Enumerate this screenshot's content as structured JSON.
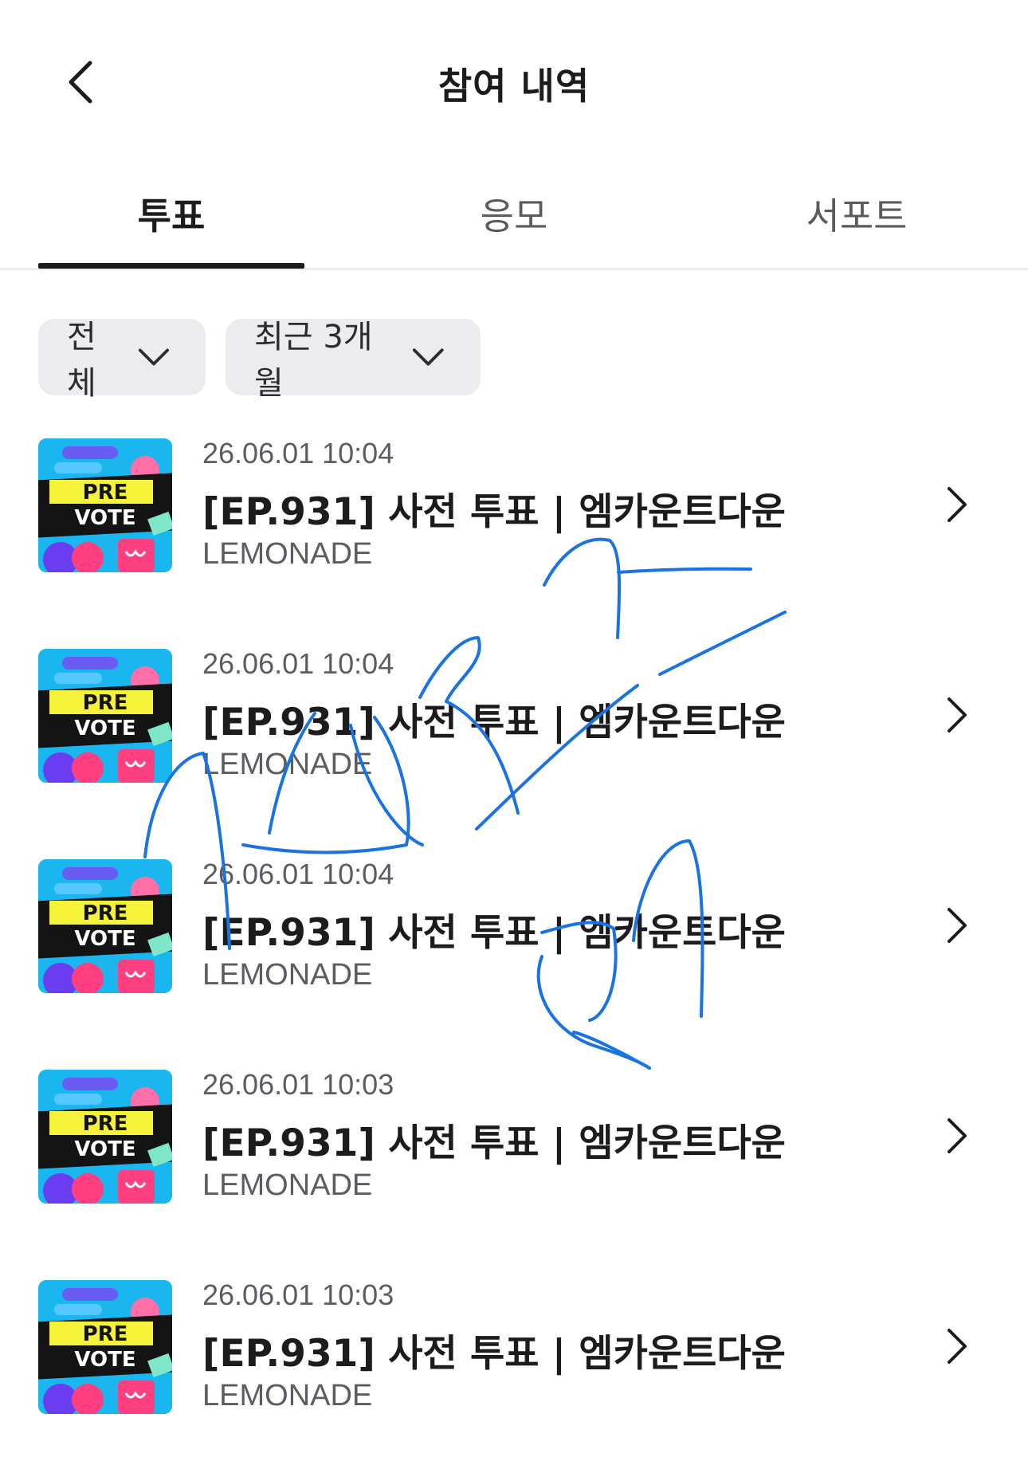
{
  "header": {
    "title": "참여 내역",
    "back_icon": "chevron-left-icon"
  },
  "tabs": [
    {
      "label": "투표",
      "active": true
    },
    {
      "label": "응모",
      "active": false
    },
    {
      "label": "서포트",
      "active": false
    }
  ],
  "filters": [
    {
      "label": "전체",
      "icon": "chevron-down-icon"
    },
    {
      "label": "최근 3개월",
      "icon": "chevron-down-icon"
    }
  ],
  "items": [
    {
      "timestamp": "26.06.01 10:04",
      "title": "[EP.931] 사전 투표 | 엠카운트다운",
      "subtitle": "LEMONADE",
      "thumb_line1": "PRE",
      "thumb_line2": "VOTE"
    },
    {
      "timestamp": "26.06.01 10:04",
      "title": "[EP.931] 사전 투표 | 엠카운트다운",
      "subtitle": "LEMONADE",
      "thumb_line1": "PRE",
      "thumb_line2": "VOTE"
    },
    {
      "timestamp": "26.06.01 10:04",
      "title": "[EP.931] 사전 투표 | 엠카운트다운",
      "subtitle": "LEMONADE",
      "thumb_line1": "PRE",
      "thumb_line2": "VOTE"
    },
    {
      "timestamp": "26.06.01 10:03",
      "title": "[EP.931] 사전 투표 | 엠카운트다운",
      "subtitle": "LEMONADE",
      "thumb_line1": "PRE",
      "thumb_line2": "VOTE"
    },
    {
      "timestamp": "26.06.01 10:03",
      "title": "[EP.931] 사전 투표 | 엠카운트다운",
      "subtitle": "LEMONADE",
      "thumb_line1": "PRE",
      "thumb_line2": "VOTE"
    }
  ],
  "colors": {
    "accent": "#1c1c1e",
    "chip_bg": "#ececef",
    "doodle": "#1a73e0",
    "thumb_bg": "#19b6f0",
    "thumb_band": "#f5f23a"
  }
}
